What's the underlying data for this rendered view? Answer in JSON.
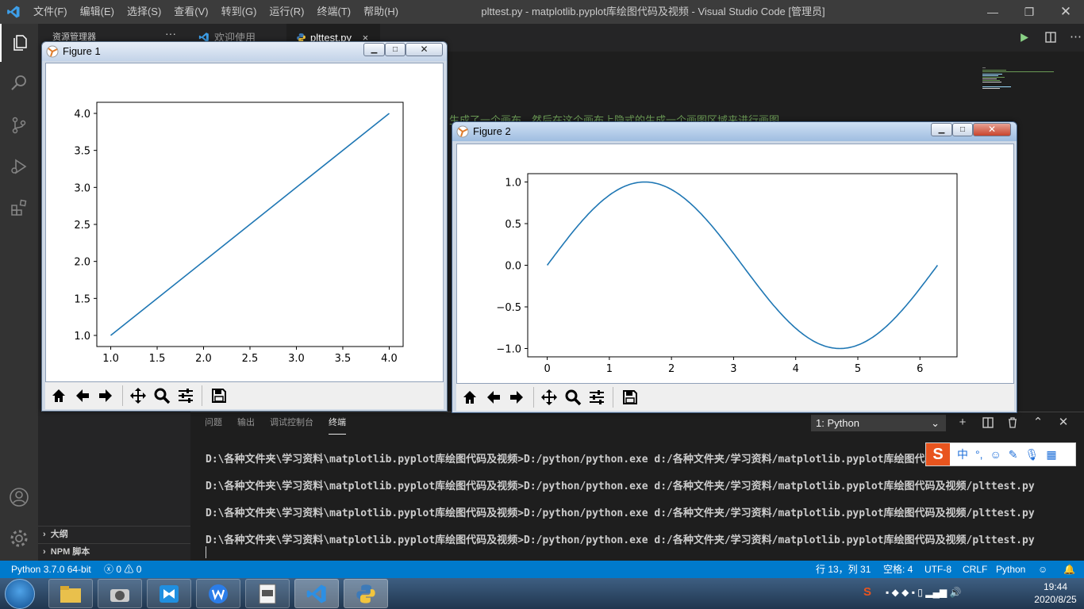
{
  "window_title": "plttest.py - matplotlib.pyplot库绘图代码及视频 - Visual Studio Code [管理员]",
  "menu": [
    "文件(F)",
    "编辑(E)",
    "选择(S)",
    "查看(V)",
    "转到(G)",
    "运行(R)",
    "终端(T)",
    "帮助(H)"
  ],
  "sidebar": {
    "title": "资源管理器",
    "more": "···",
    "sections": [
      "大纲",
      "NPM 脚本"
    ]
  },
  "tabs": [
    {
      "label": "欢迎使用",
      "icon": "vscode-icon"
    },
    {
      "label": "plttest.py",
      "icon": "python-file-icon",
      "close": "×"
    }
  ],
  "editor": {
    "partial_comment": "生成了一个画布，然后在这个画布上隐式的生成一个画图区域来进行画图"
  },
  "panel": {
    "tabs": [
      "问题",
      "输出",
      "调试控制台",
      "终端"
    ],
    "active_tab": "终端",
    "terminal_select": "1: Python",
    "terminal_lines": [
      "D:\\各种文件夹\\学习资料\\matplotlib.pyplot库绘图代码及视频>D:/python/python.exe d:/各种文件夹/学习资料/matplotlib.pyplot库绘图代码及视",
      "D:\\各种文件夹\\学习资料\\matplotlib.pyplot库绘图代码及视频>D:/python/python.exe d:/各种文件夹/学习资料/matplotlib.pyplot库绘图代码及视频/plttest.py",
      "D:\\各种文件夹\\学习资料\\matplotlib.pyplot库绘图代码及视频>D:/python/python.exe d:/各种文件夹/学习资料/matplotlib.pyplot库绘图代码及视频/plttest.py",
      "D:\\各种文件夹\\学习资料\\matplotlib.pyplot库绘图代码及视频>D:/python/python.exe d:/各种文件夹/学习资料/matplotlib.pyplot库绘图代码及视频/plttest.py"
    ]
  },
  "ime": {
    "mode": "中",
    "punct": "°,"
  },
  "statusbar": {
    "interpreter": "Python 3.7.0 64-bit",
    "errors": "0",
    "warnings": "0",
    "position": "行 13，列 31",
    "spaces": "空格: 4",
    "encoding": "UTF-8",
    "eol": "CRLF",
    "language": "Python"
  },
  "clock": {
    "time": "19:44",
    "date": "2020/8/25"
  },
  "figure1": {
    "title": "Figure 1"
  },
  "figure2": {
    "title": "Figure 2"
  },
  "colors": {
    "line": "#1f77b4",
    "statusbar": "#007acc"
  },
  "chart_data": [
    {
      "type": "line",
      "title": "",
      "xlabel": "",
      "ylabel": "",
      "x": [
        1.0,
        2.0,
        3.0,
        4.0
      ],
      "y": [
        1.0,
        2.0,
        3.0,
        4.0
      ],
      "xlim": [
        0.85,
        4.15
      ],
      "ylim": [
        0.85,
        4.15
      ],
      "xticks": [
        "1.0",
        "1.5",
        "2.0",
        "2.5",
        "3.0",
        "3.5",
        "4.0"
      ],
      "yticks": [
        "1.0",
        "1.5",
        "2.0",
        "2.5",
        "3.0",
        "3.5",
        "4.0"
      ],
      "grid": false,
      "legend": "none"
    },
    {
      "type": "line",
      "title": "",
      "xlabel": "",
      "ylabel": "",
      "function": "sin(x)",
      "x_range": [
        0,
        6.283
      ],
      "xlim": [
        -0.314,
        6.597
      ],
      "ylim": [
        -1.1,
        1.1
      ],
      "xticks": [
        "0",
        "1",
        "2",
        "3",
        "4",
        "5",
        "6"
      ],
      "yticks": [
        "1.0",
        "0.5",
        "0.0",
        "−0.5",
        "−1.0"
      ],
      "grid": false,
      "legend": "none"
    }
  ]
}
